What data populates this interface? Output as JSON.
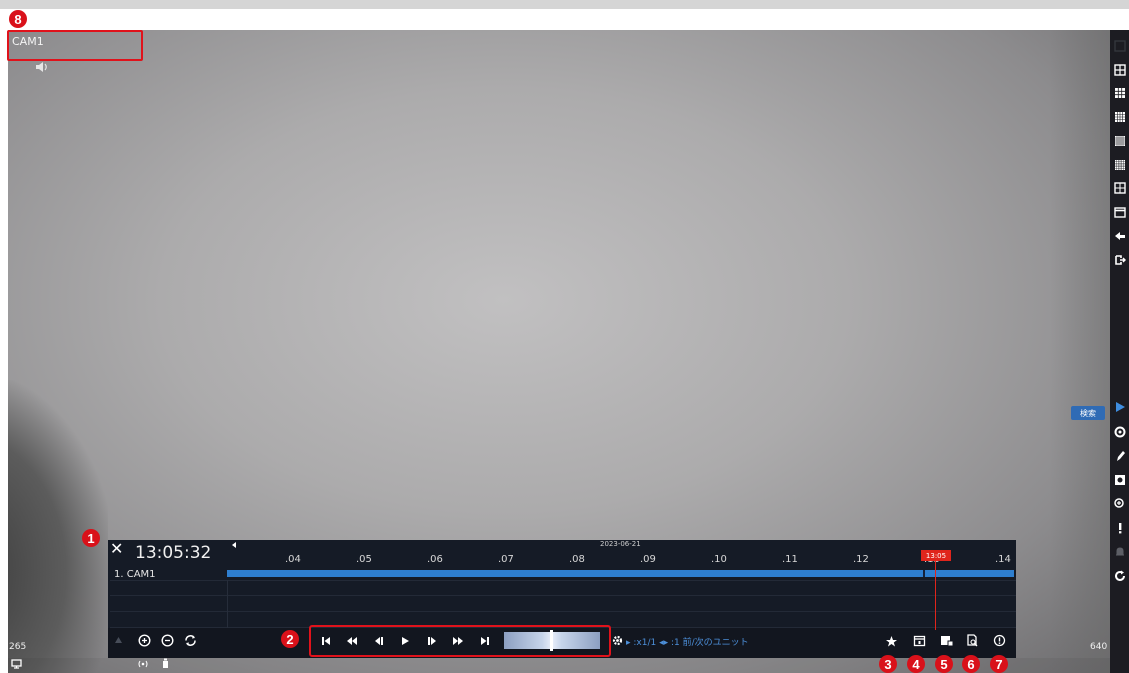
{
  "video": {
    "camera_title": "CAM1",
    "markers": {
      "m1": "1",
      "m2": "2",
      "m3": "3",
      "m4": "4",
      "m5": "5",
      "m6": "6",
      "m7": "7",
      "m8": "8"
    }
  },
  "sidebar": {
    "search_tag": "検索",
    "icons": [
      "layout-1-icon",
      "layout-4-icon",
      "layout-9-icon",
      "layout-16-icon",
      "layout-25-icon",
      "layout-36-icon",
      "layout-custom-icon",
      "calendar-icon",
      "back-icon",
      "logout-icon",
      "play-icon",
      "eye-icon",
      "pen-icon",
      "snapshot-icon",
      "zoom-icon",
      "alert-icon",
      "bell-icon",
      "refresh-icon"
    ]
  },
  "playback": {
    "close_label": "✕",
    "time": "13:05:32",
    "date": "2023-06-21",
    "camera_row": "1. CAM1",
    "ticks": [
      ".04",
      ".05",
      ".06",
      ".07",
      ".08",
      ".09",
      ".10",
      ".11",
      ".12",
      ".13",
      ".14"
    ],
    "cursor_time": "13:05",
    "speed": "x1/1",
    "step_unit": ":1 前/次のユニット"
  },
  "status": {
    "left_code": "265",
    "right_code": "640"
  },
  "colors": {
    "accent_red": "#e0121b",
    "timeline_blue": "#2e7fd0",
    "panel_bg": "#151b26"
  }
}
